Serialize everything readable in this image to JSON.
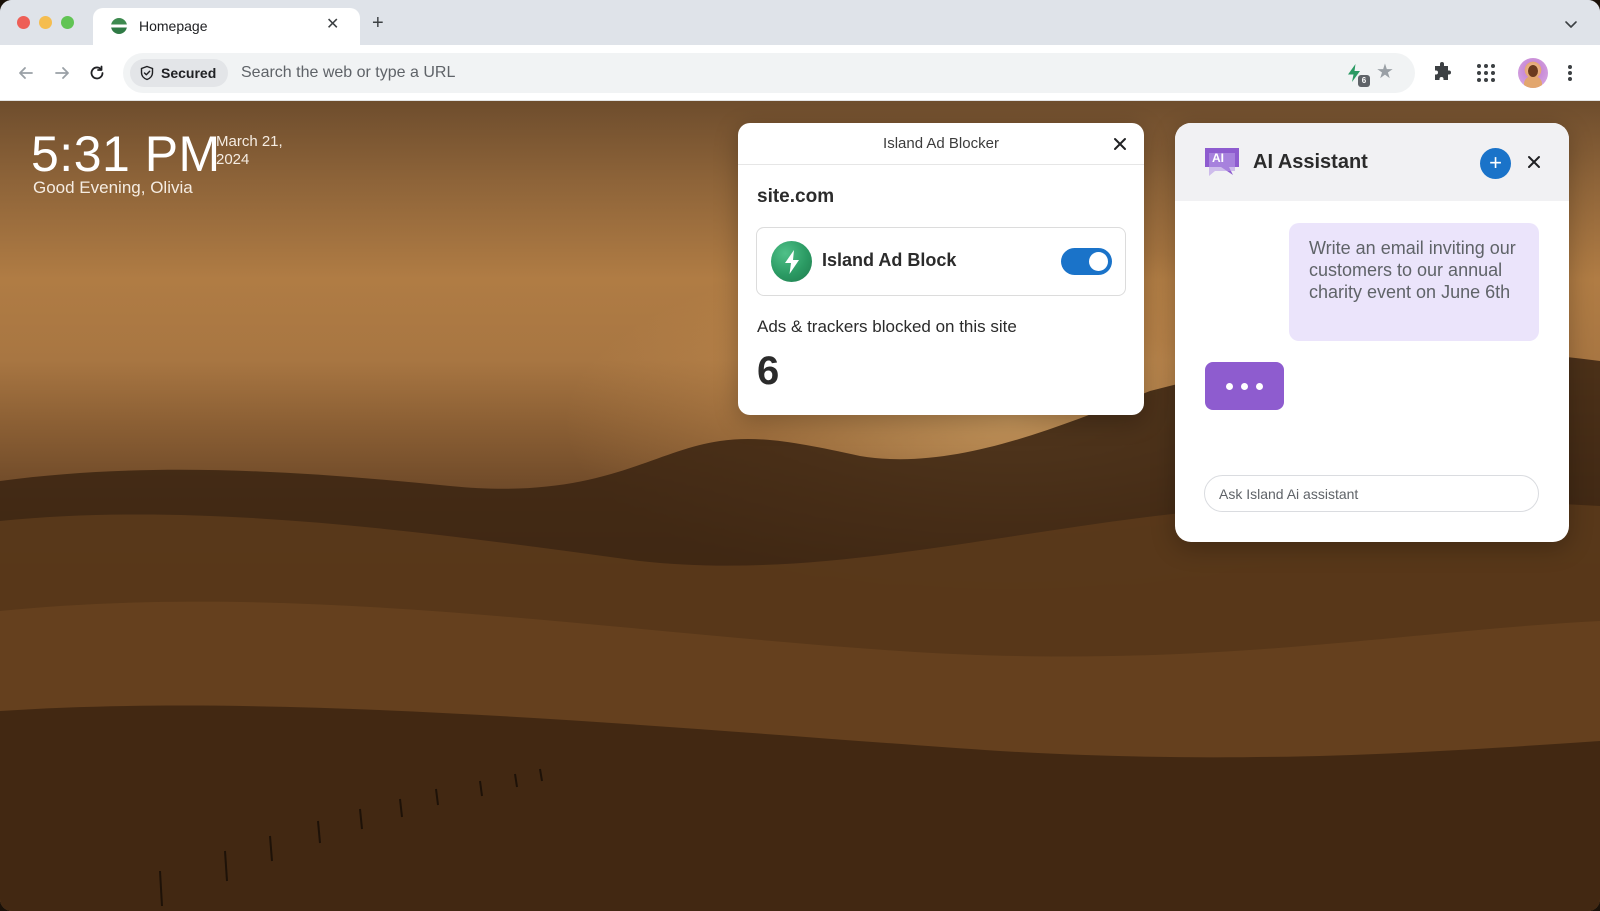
{
  "tab": {
    "title": "Homepage"
  },
  "omnibox": {
    "security_label": "Secured",
    "placeholder": "Search the web or type a URL",
    "extension_badge": "6"
  },
  "homepage": {
    "time": "5:31 PM",
    "date": "March 21, 2024",
    "greeting": "Good Evening, Olivia"
  },
  "ad_blocker": {
    "title": "Island Ad Blocker",
    "site": "site.com",
    "feature_name": "Island Ad Block",
    "enabled": true,
    "stat_label": "Ads & trackers blocked on this site",
    "blocked_count": "6"
  },
  "ai_assistant": {
    "title": "AI Assistant",
    "logo_text": "AI",
    "user_message": "Write an email inviting our customers to our annual charity event on June 6th",
    "input_placeholder": "Ask Island Ai assistant"
  },
  "colors": {
    "accent": "#1a73c9",
    "ai_purple": "#8e5ccf",
    "user_bubble": "#ebe4fb",
    "ad_block_green": "#2b9a63"
  }
}
